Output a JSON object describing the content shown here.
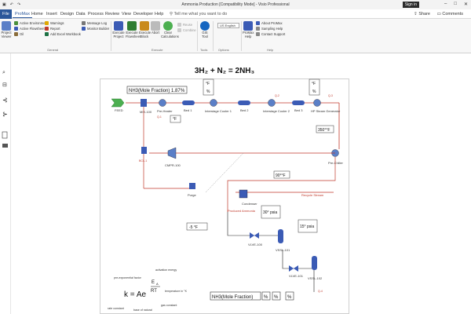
{
  "titlebar": {
    "title": "Ammonia Production [Compatibility Mode] - Visio Professional",
    "signin": "Sign in",
    "quick": [
      "↶",
      "↷"
    ]
  },
  "tabs": [
    "File",
    "ProMax",
    "Home",
    "Insert",
    "Design",
    "Data",
    "Process",
    "Review",
    "View",
    "Developer",
    "Help"
  ],
  "tell_me": "Tell me what you want to do",
  "share": "Share",
  "comments": "Comments",
  "ribbon": {
    "project_viewer": "Project Viewer",
    "active_environment": "Active Environment",
    "active_flowsheet": "Active Flowsheet",
    "oil": "Oil",
    "warnings": "Warnings",
    "report": "Report",
    "add_excel_workbook": "Add Excel Workbook",
    "message_log": "Message Log",
    "monitor_builder": "Monitor Builder",
    "execute_project": "Execute Project",
    "execute_flowsheet": "Execute Flowsheet",
    "execute_block": "Execute Block",
    "abort": "Abort",
    "clear_calculations": "Clear Calculations",
    "reuse": "Reuse",
    "combine": "Combine",
    "gis_tool": "GIS Tool",
    "units": "US English",
    "promax_help": "ProMax Help",
    "about_promax": "About ProMax",
    "sampling_help": "Sampling Help",
    "contact_support": "Contact Support",
    "group_general": "General",
    "group_execute": "Execute",
    "group_tools": "Tools",
    "group_options": "Options",
    "group_help": "Help"
  },
  "diagram": {
    "equation_top": "3H₂ + N₂ = 2NH₃",
    "nh3_label": "NH3(Mole Fraction)",
    "nh3_value": "1.87",
    "nh3_unit": "%",
    "temp_unit": "°F",
    "pct_unit": "%",
    "feed": "FEED",
    "mix": "MIX-100",
    "pre_heater": "Pre-Heater",
    "bed1": "Bed 1",
    "intercooler1": "Interstage Cooler 1",
    "bed2": "Bed 2",
    "intercooler2": "Interstage Cooler 2",
    "bed3": "Bed 3",
    "hp_steam": "HP Steam Generator",
    "pre_chiller": "Pre-Chiller",
    "temp_350": "350°°F",
    "cmpr": "CMPR-100",
    "purge": "Purge",
    "bcl": "BCL-1",
    "condenser": "Condenser",
    "temp_90": "90°°F",
    "recycle": "Recycle Stream",
    "product": "Produced Ammonia",
    "psia_30": "30° psia",
    "psia_15": "15° psia",
    "temp_m5": "-5 °F",
    "vlve100": "VLVE-100",
    "vssl101": "VSSL-101",
    "vlve101": "VLVE-101",
    "vssl102": "VSSL-102",
    "nh3_bottom": "NH3(Mole Fraction)",
    "pct_a": "%",
    "pct_b": "%",
    "pct_c": "%",
    "q1": "Q-1",
    "q2": "Q-2",
    "q3": "Q-3",
    "q4": "Q-4"
  },
  "arrhenius": {
    "lhs": "k = Ae",
    "exp_num": "E",
    "exp_sub": "A",
    "exp_den": "RT",
    "pre_exponential": "pre-exponential factor",
    "activation_energy": "activation energy",
    "temperature": "temperature in °K",
    "gas_constant": "gas constant",
    "rate_constant": "rate constant",
    "base_natural": "base of natural"
  },
  "colors": {
    "file_tab": "#2b579a",
    "stream_red": "#c0392b",
    "stream_black": "#222222",
    "equipment_blue": "#3b5bb5"
  }
}
